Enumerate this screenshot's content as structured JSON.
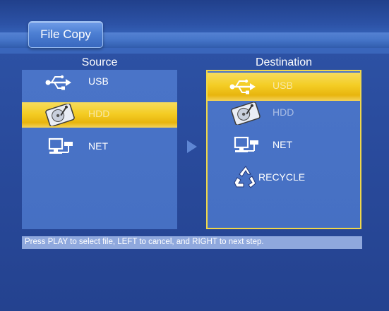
{
  "window": {
    "title": "File Copy"
  },
  "columns": {
    "source_header": "Source",
    "destination_header": "Destination"
  },
  "source": {
    "items": [
      {
        "label": "USB",
        "icon": "usb-icon",
        "state": "normal"
      },
      {
        "label": "HDD",
        "icon": "hard-disk-icon",
        "state": "selected"
      },
      {
        "label": "NET",
        "icon": "network-computer-icon",
        "state": "normal"
      }
    ]
  },
  "destination": {
    "items": [
      {
        "label": "USB",
        "icon": "usb-icon",
        "state": "selected"
      },
      {
        "label": "HDD",
        "icon": "hard-disk-icon",
        "state": "disabled"
      },
      {
        "label": "NET",
        "icon": "network-computer-icon",
        "state": "normal"
      },
      {
        "label": "RECYCLE",
        "icon": "recycle-icon",
        "state": "normal"
      }
    ]
  },
  "status": {
    "hint": "Press PLAY to select file, LEFT to cancel, and RIGHT to next step."
  },
  "colors": {
    "background": "#2a4c9e",
    "panel": "#4a74c8",
    "selection": "#f4cd24",
    "focus_border": "#f0d74a",
    "statusbar": "#8fa8dd"
  }
}
